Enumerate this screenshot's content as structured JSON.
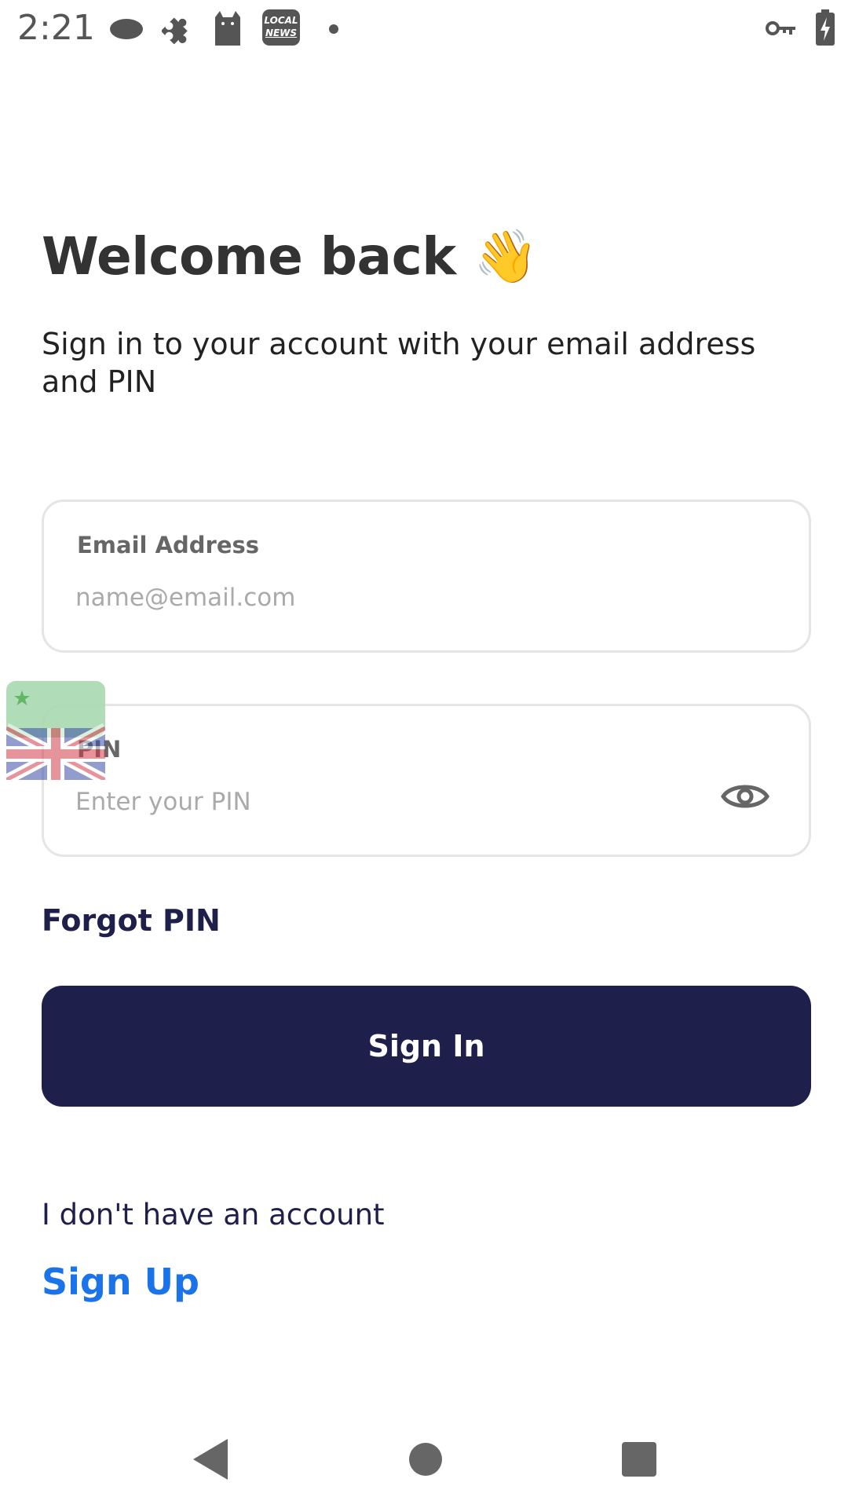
{
  "status_bar": {
    "time": "2:21",
    "news_icon_text_line1": "LOCAL",
    "news_icon_text_line2": "NEWS"
  },
  "title": "Welcome back 👋",
  "subtitle": "Sign in to your account with your email address and PIN",
  "email_field": {
    "label": "Email Address",
    "placeholder": "name@email.com",
    "value": ""
  },
  "pin_field": {
    "label": "PIN",
    "placeholder": "Enter your PIN",
    "value": ""
  },
  "forgot_pin": "Forgot PIN",
  "sign_in_button": "Sign In",
  "no_account_text": "I don't have an account",
  "sign_up_link": "Sign Up",
  "colors": {
    "primary": "#1f1f4c",
    "link": "#1a73e8",
    "border": "#e5e5e5"
  },
  "icons": {
    "status_bar": [
      "cloud-icon",
      "puzzle-icon",
      "cat-icon",
      "local-news-icon",
      "dot-icon",
      "vpn-key-icon",
      "battery-charging-icon"
    ],
    "overlay": "uk-flag-language-icon",
    "pin_visibility": "eye-icon",
    "navigation": [
      "back-icon",
      "home-icon",
      "recents-icon"
    ]
  }
}
